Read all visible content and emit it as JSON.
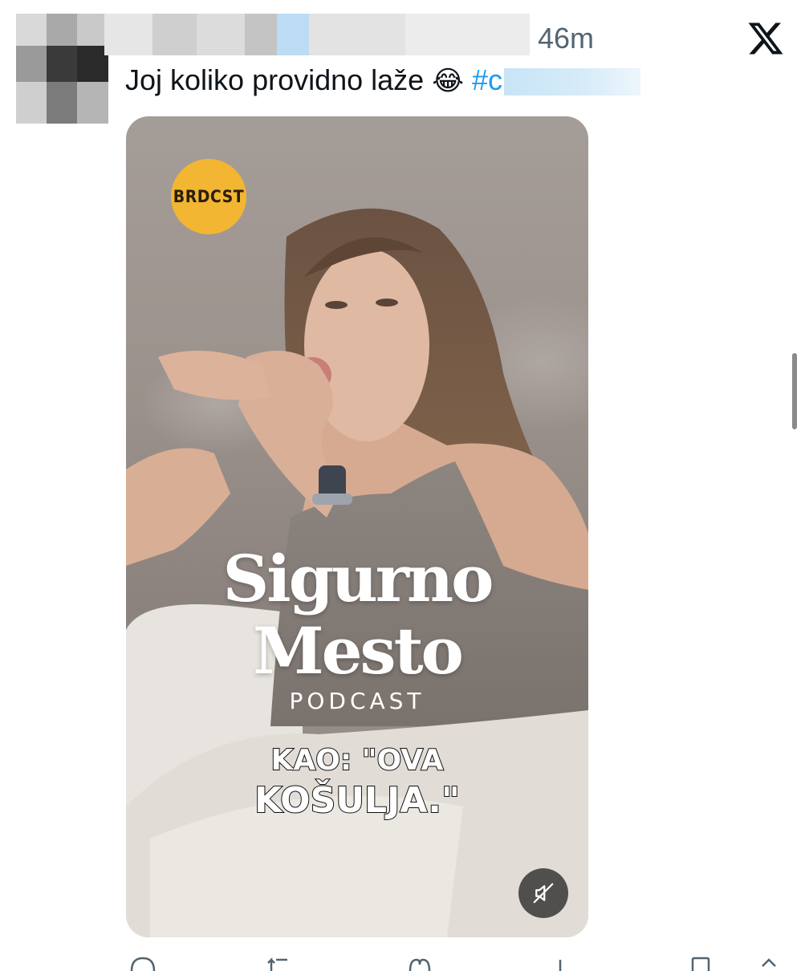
{
  "tweet": {
    "timestamp": "46m",
    "text": "Joj koliko providno laže",
    "emoji": "😂",
    "hashtag_prefix": "#c"
  },
  "header": {
    "platform_icon": "x-logo-icon"
  },
  "media": {
    "badge": "BRDCST",
    "title_line1": "Sigurno",
    "title_line2": "Mesto",
    "subtitle": "PODCAST",
    "caption_line1": "KAO: \"OVA",
    "caption_line2": "KOŠULJA.\"",
    "mute_icon": "muted-speaker-icon"
  },
  "actions": {
    "icons": [
      "reply-icon",
      "repost-icon",
      "like-icon",
      "views-icon",
      "bookmark-icon",
      "share-icon"
    ]
  },
  "colors": {
    "link": "#1d9bf0",
    "timestamp": "#536471",
    "badge": "#f2b632"
  }
}
